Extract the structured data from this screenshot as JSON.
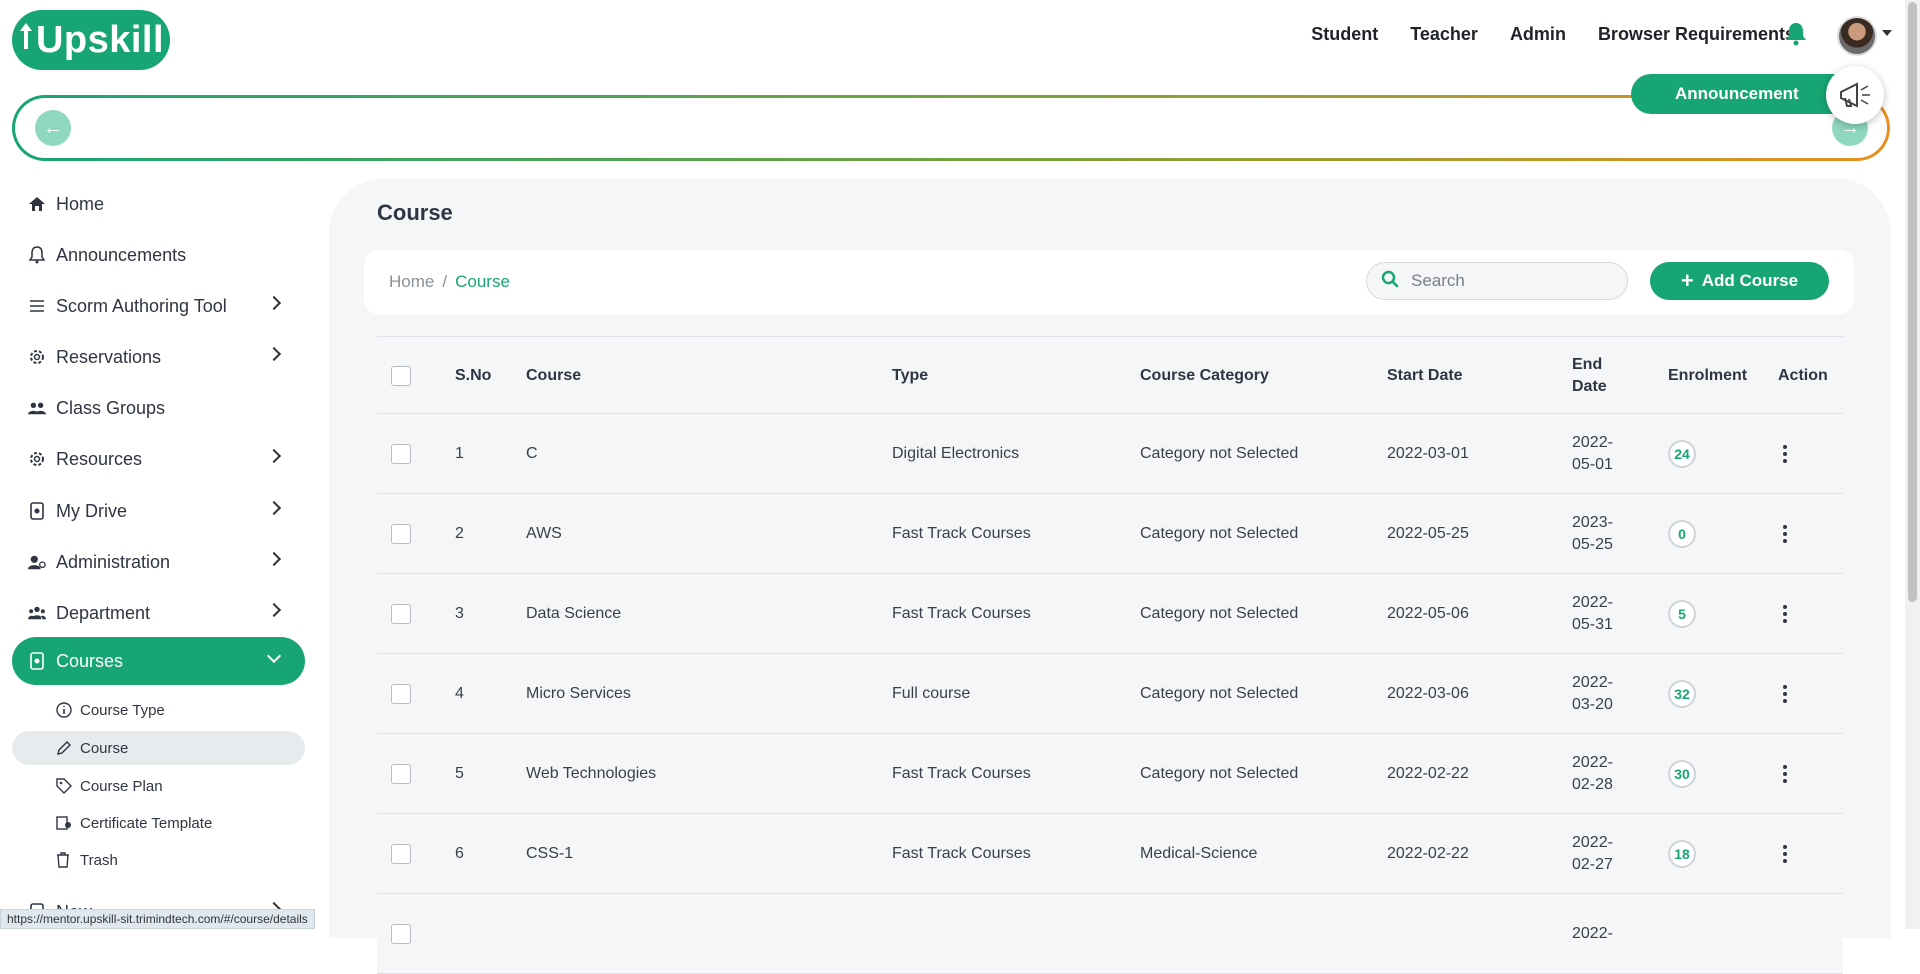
{
  "header": {
    "logo": "Upskill",
    "nav": [
      "Student",
      "Teacher",
      "Admin",
      "Browser Requirements"
    ],
    "bell_icon": "bell-icon",
    "avatar_icon": "user-avatar"
  },
  "announcement": {
    "label": "Announcement",
    "prev_icon": "arrow-left-icon",
    "next_icon": "arrow-right-icon",
    "megaphone_icon": "megaphone-icon"
  },
  "sidebar": {
    "items": [
      {
        "label": "Home",
        "icon": "home-icon"
      },
      {
        "label": "Announcements",
        "icon": "bell-icon"
      },
      {
        "label": "Scorm Authoring Tool",
        "icon": "list-icon"
      },
      {
        "label": "Reservations",
        "icon": "gear-icon"
      },
      {
        "label": "Class Groups",
        "icon": "people-icon"
      },
      {
        "label": "Resources",
        "icon": "gear-icon"
      },
      {
        "label": "My Drive",
        "icon": "drive-icon"
      },
      {
        "label": "Administration",
        "icon": "user-gear-icon"
      },
      {
        "label": "Department",
        "icon": "users-icon"
      },
      {
        "label": "Courses",
        "icon": "course-icon"
      }
    ],
    "sub_items": [
      {
        "label": "Course Type",
        "icon": "info-icon"
      },
      {
        "label": "Course",
        "icon": "pencil-icon"
      },
      {
        "label": "Course Plan",
        "icon": "tag-icon"
      },
      {
        "label": "Certificate Template",
        "icon": "certificate-icon"
      },
      {
        "label": "Trash",
        "icon": "trash-icon"
      }
    ],
    "partial_item": "New"
  },
  "main": {
    "title": "Course",
    "breadcrumb": {
      "home": "Home",
      "sep": "/",
      "current": "Course"
    },
    "search_placeholder": "Search",
    "add_button": "Add Course",
    "columns": [
      "S.No",
      "Course",
      "Type",
      "Course Category",
      "Start Date",
      "End Date",
      "Enrolment",
      "Action"
    ],
    "rows": [
      {
        "sno": "1",
        "course": "C",
        "type": "Digital Electronics",
        "category": "Category not Selected",
        "start": "2022-03-01",
        "end1": "2022-",
        "end2": "05-01",
        "enrolment": "24"
      },
      {
        "sno": "2",
        "course": "AWS",
        "type": "Fast Track Courses",
        "category": "Category not Selected",
        "start": "2022-05-25",
        "end1": "2023-",
        "end2": "05-25",
        "enrolment": "0"
      },
      {
        "sno": "3",
        "course": "Data Science",
        "type": "Fast Track Courses",
        "category": "Category not Selected",
        "start": "2022-05-06",
        "end1": "2022-",
        "end2": "05-31",
        "enrolment": "5"
      },
      {
        "sno": "4",
        "course": "Micro Services",
        "type": "Full course",
        "category": "Category not Selected",
        "start": "2022-03-06",
        "end1": "2022-",
        "end2": "03-20",
        "enrolment": "32"
      },
      {
        "sno": "5",
        "course": "Web Technologies",
        "type": "Fast Track Courses",
        "category": "Category not Selected",
        "start": "2022-02-22",
        "end1": "2022-",
        "end2": "02-28",
        "enrolment": "30"
      },
      {
        "sno": "6",
        "course": "CSS-1",
        "type": "Fast Track Courses",
        "category": "Medical-Science",
        "start": "2022-02-22",
        "end1": "2022-",
        "end2": "02-27",
        "enrolment": "18"
      },
      {
        "sno": "",
        "course": "",
        "type": "",
        "category": "",
        "start": "",
        "end1": "2022-",
        "end2": "",
        "enrolment": ""
      }
    ]
  },
  "statusbar": {
    "url": "https://mentor.upskill-sit.trimindtech.com/#/course/details"
  },
  "colors": {
    "brand": "#17a673",
    "panel": "#f4f6f7",
    "gradient_end": "#e8901f"
  }
}
